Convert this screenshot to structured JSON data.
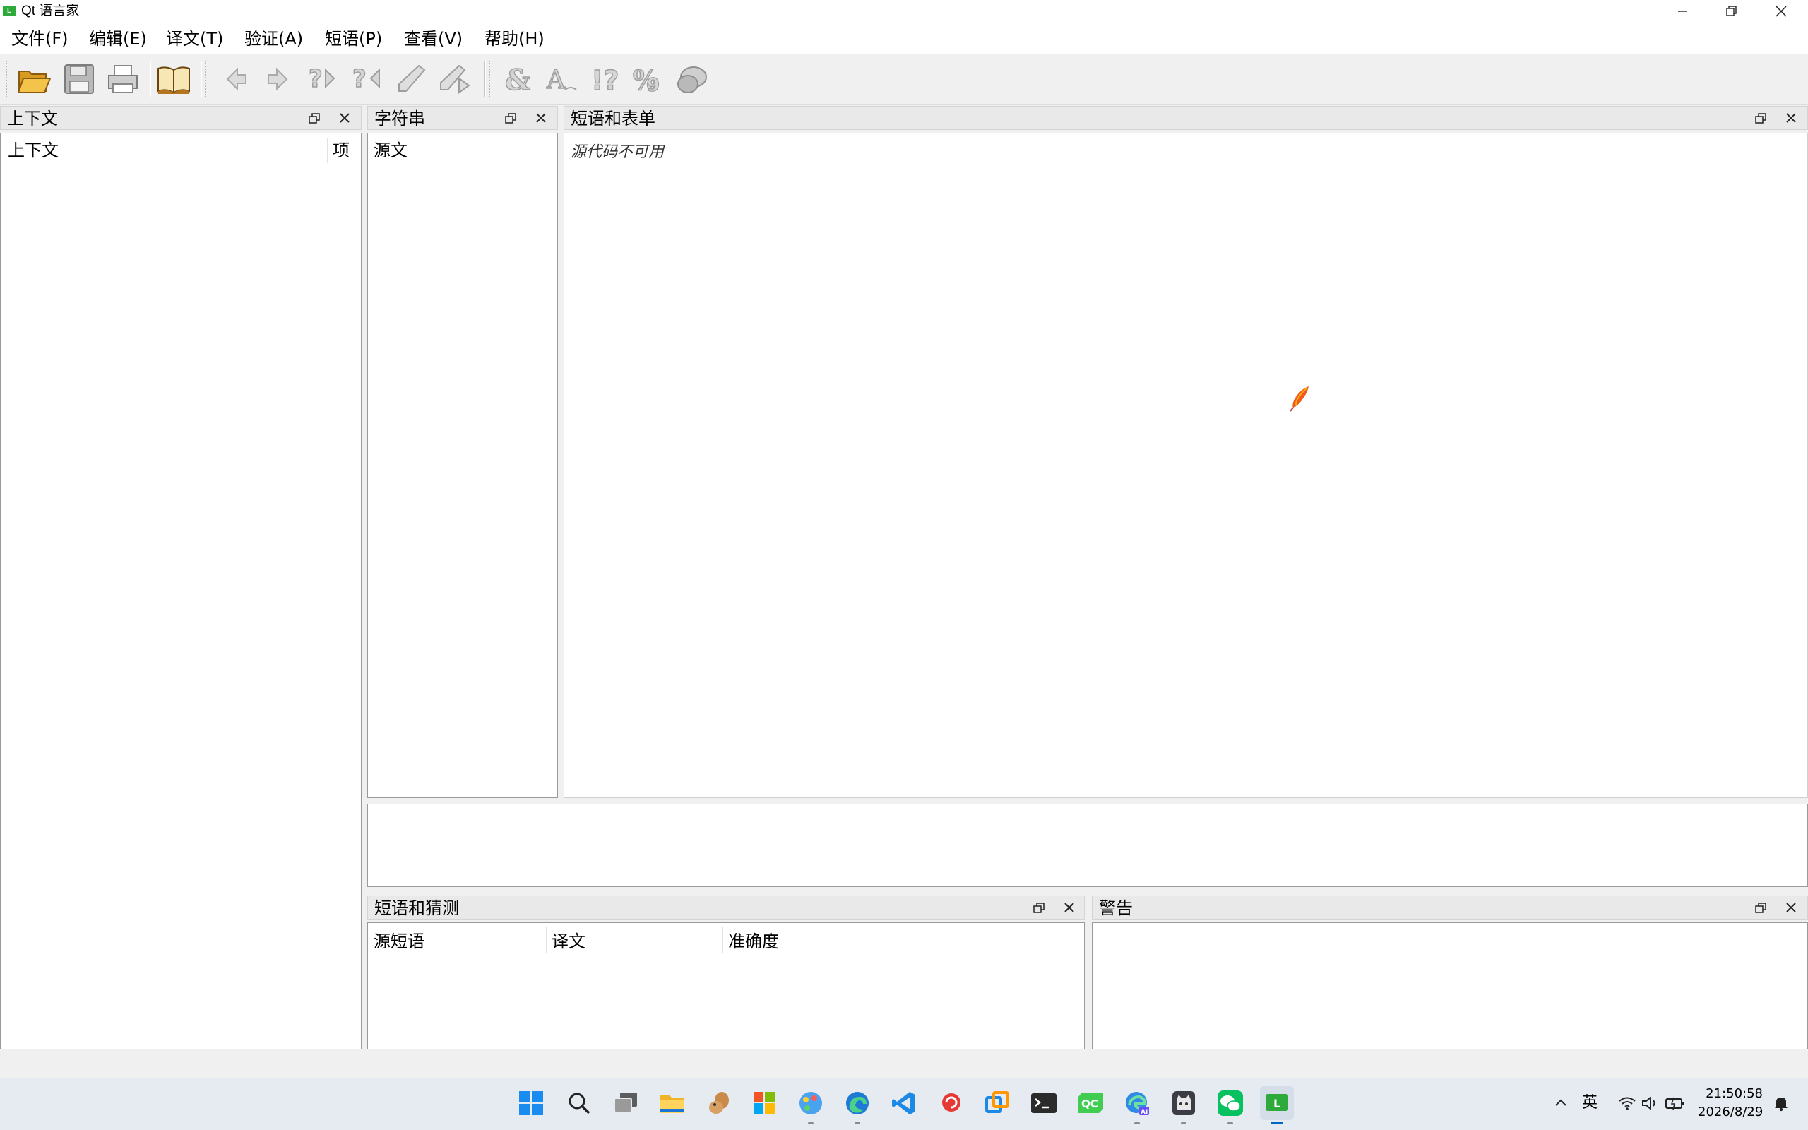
{
  "window": {
    "title": "Qt 语言家",
    "app_icon_letter": "L"
  },
  "menu": [
    {
      "label": "文件(F)"
    },
    {
      "label": "编辑(E)"
    },
    {
      "label": "译文(T)"
    },
    {
      "label": "验证(A)"
    },
    {
      "label": "短语(P)"
    },
    {
      "label": "查看(V)"
    },
    {
      "label": "帮助(H)"
    }
  ],
  "toolbar": {
    "buttons": [
      "open-icon",
      "save-icon",
      "print-icon",
      "phrasebook-icon",
      "prev-icon",
      "next-icon",
      "prev-unfinished-icon",
      "next-unfinished-icon",
      "done-icon",
      "done-and-next-icon",
      "accelerators-icon",
      "punctuation-icon",
      "phrase-match-icon",
      "place-markers-icon",
      "surrounding-whitespace-icon"
    ]
  },
  "context_panel": {
    "title": "上下文",
    "columns": [
      "上下文",
      "项"
    ]
  },
  "strings_panel": {
    "title": "字符串",
    "columns": [
      "源文"
    ]
  },
  "forms_panel": {
    "title": "短语和表单",
    "source_unavailable": "源代码不可用"
  },
  "guesses_panel": {
    "title": "短语和猜测",
    "columns": [
      "源短语",
      "译文",
      "准确度"
    ]
  },
  "warnings_panel": {
    "title": "警告"
  },
  "taskbar": {
    "apps": [
      "windows-start-icon",
      "search-icon",
      "task-view-icon",
      "file-explorer-icon",
      "squirrel-app-icon",
      "store-icon",
      "paint-icon",
      "edge-icon",
      "vscode-icon",
      "snail-app-icon",
      "copy-app-icon",
      "terminal-icon",
      "qt-creator-icon",
      "edge-ai-icon",
      "cat-app-icon",
      "wechat-icon",
      "linguist-icon"
    ],
    "ime": "英",
    "time": "21:50:58",
    "date": "2026/8/29"
  },
  "colors": {
    "accent": "#0067c0",
    "panel_title_bg": "#e9e9e9"
  }
}
